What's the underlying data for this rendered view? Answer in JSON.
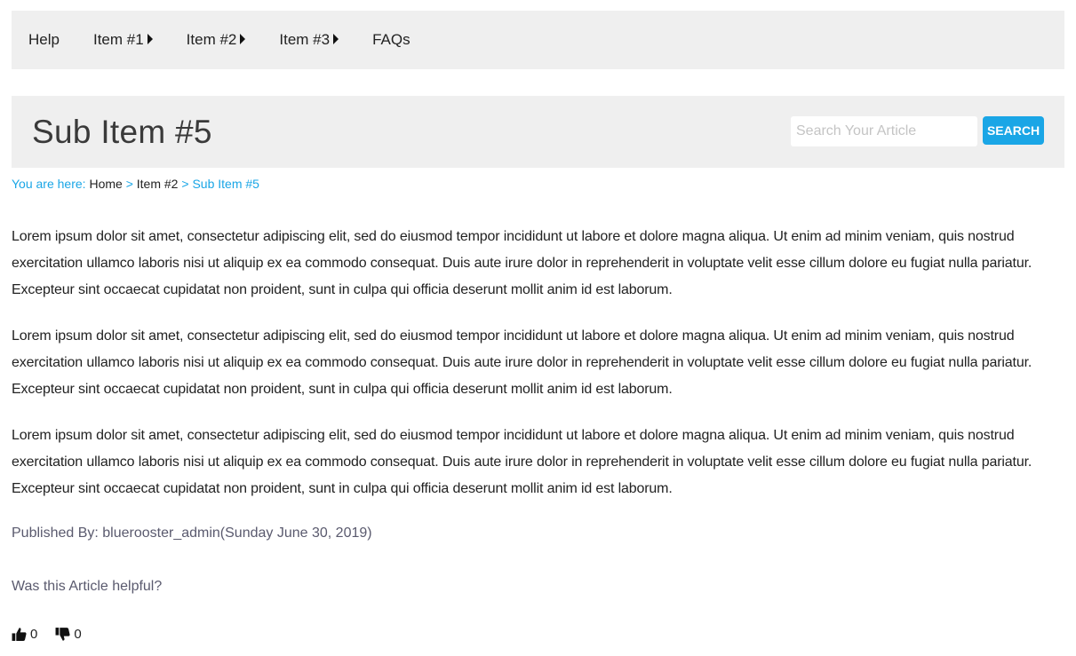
{
  "nav": {
    "items": [
      {
        "label": "Help",
        "has_caret": false
      },
      {
        "label": "Item #1",
        "has_caret": true
      },
      {
        "label": "Item #2",
        "has_caret": true
      },
      {
        "label": "Item #3",
        "has_caret": true
      },
      {
        "label": "FAQs",
        "has_caret": false
      }
    ]
  },
  "header": {
    "title": "Sub Item #5",
    "search_placeholder": "Search Your Article",
    "search_button": "SEARCH"
  },
  "breadcrumb": {
    "prefix": "You are here:",
    "home": "Home",
    "separator": ">",
    "parent": "Item #2",
    "current": "Sub Item #5"
  },
  "article": {
    "paragraphs": [
      "Lorem ipsum dolor sit amet, consectetur adipiscing elit, sed do eiusmod tempor incididunt ut labore et dolore magna aliqua. Ut enim ad minim veniam, quis nostrud exercitation ullamco laboris nisi ut aliquip ex ea commodo consequat. Duis aute irure dolor in reprehenderit in voluptate velit esse cillum dolore eu fugiat nulla pariatur. Excepteur sint occaecat cupidatat non proident, sunt in culpa qui officia deserunt mollit anim id est laborum.",
      "Lorem ipsum dolor sit amet, consectetur adipiscing elit, sed do eiusmod tempor incididunt ut labore et dolore magna aliqua. Ut enim ad minim veniam, quis nostrud exercitation ullamco laboris nisi ut aliquip ex ea commodo consequat. Duis aute irure dolor in reprehenderit in voluptate velit esse cillum dolore eu fugiat nulla pariatur. Excepteur sint occaecat cupidatat non proident, sunt in culpa qui officia deserunt mollit anim id est laborum.",
      "Lorem ipsum dolor sit amet, consectetur adipiscing elit, sed do eiusmod tempor incididunt ut labore et dolore magna aliqua. Ut enim ad minim veniam, quis nostrud exercitation ullamco laboris nisi ut aliquip ex ea commodo consequat. Duis aute irure dolor in reprehenderit in voluptate velit esse cillum dolore eu fugiat nulla pariatur. Excepteur sint occaecat cupidatat non proident, sunt in culpa qui officia deserunt mollit anim id est laborum."
    ],
    "published_by": "Published By: bluerooster_admin(Sunday June 30, 2019)"
  },
  "feedback": {
    "question": "Was this Article helpful?",
    "thumbs_up_icon": "thumbs-up-icon",
    "thumbs_down_icon": "thumbs-down-icon",
    "up_count": "0",
    "down_count": "0"
  },
  "colors": {
    "accent": "#1aa6e6",
    "panel_bg": "#efefef",
    "meta_text": "#5a5a6e"
  }
}
